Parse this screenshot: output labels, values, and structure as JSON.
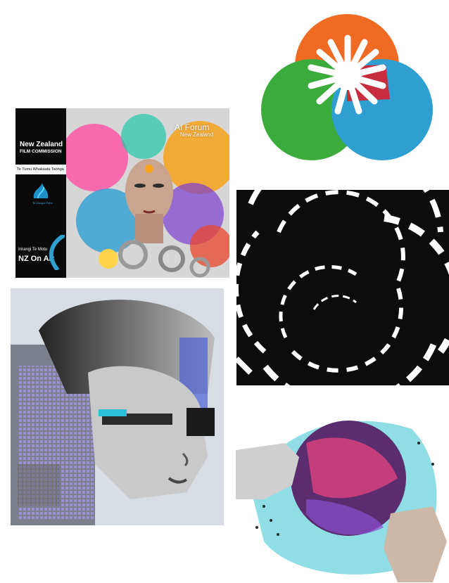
{
  "poster": {
    "sidebar": {
      "title": "New Zealand",
      "subtitle": "FILM COMMISSION",
      "te_tumu": "Te Tumu Whakaata Taonga",
      "te_mangai": "Te Mangai Paho",
      "nzonair_top": "Irirangi Te Motu",
      "nzonair": "NZ On Air"
    },
    "badge": {
      "title": "AI Forum",
      "subtitle": "New Zealand"
    }
  },
  "colors": {
    "logo_orange": "#ef6a23",
    "logo_red": "#d8202e",
    "logo_green": "#3bac3c",
    "logo_blue": "#2f9fd2",
    "swirl_bg": "#0c0c0c",
    "globe_pink": "#d8427f",
    "globe_teal": "#33c2d0"
  }
}
